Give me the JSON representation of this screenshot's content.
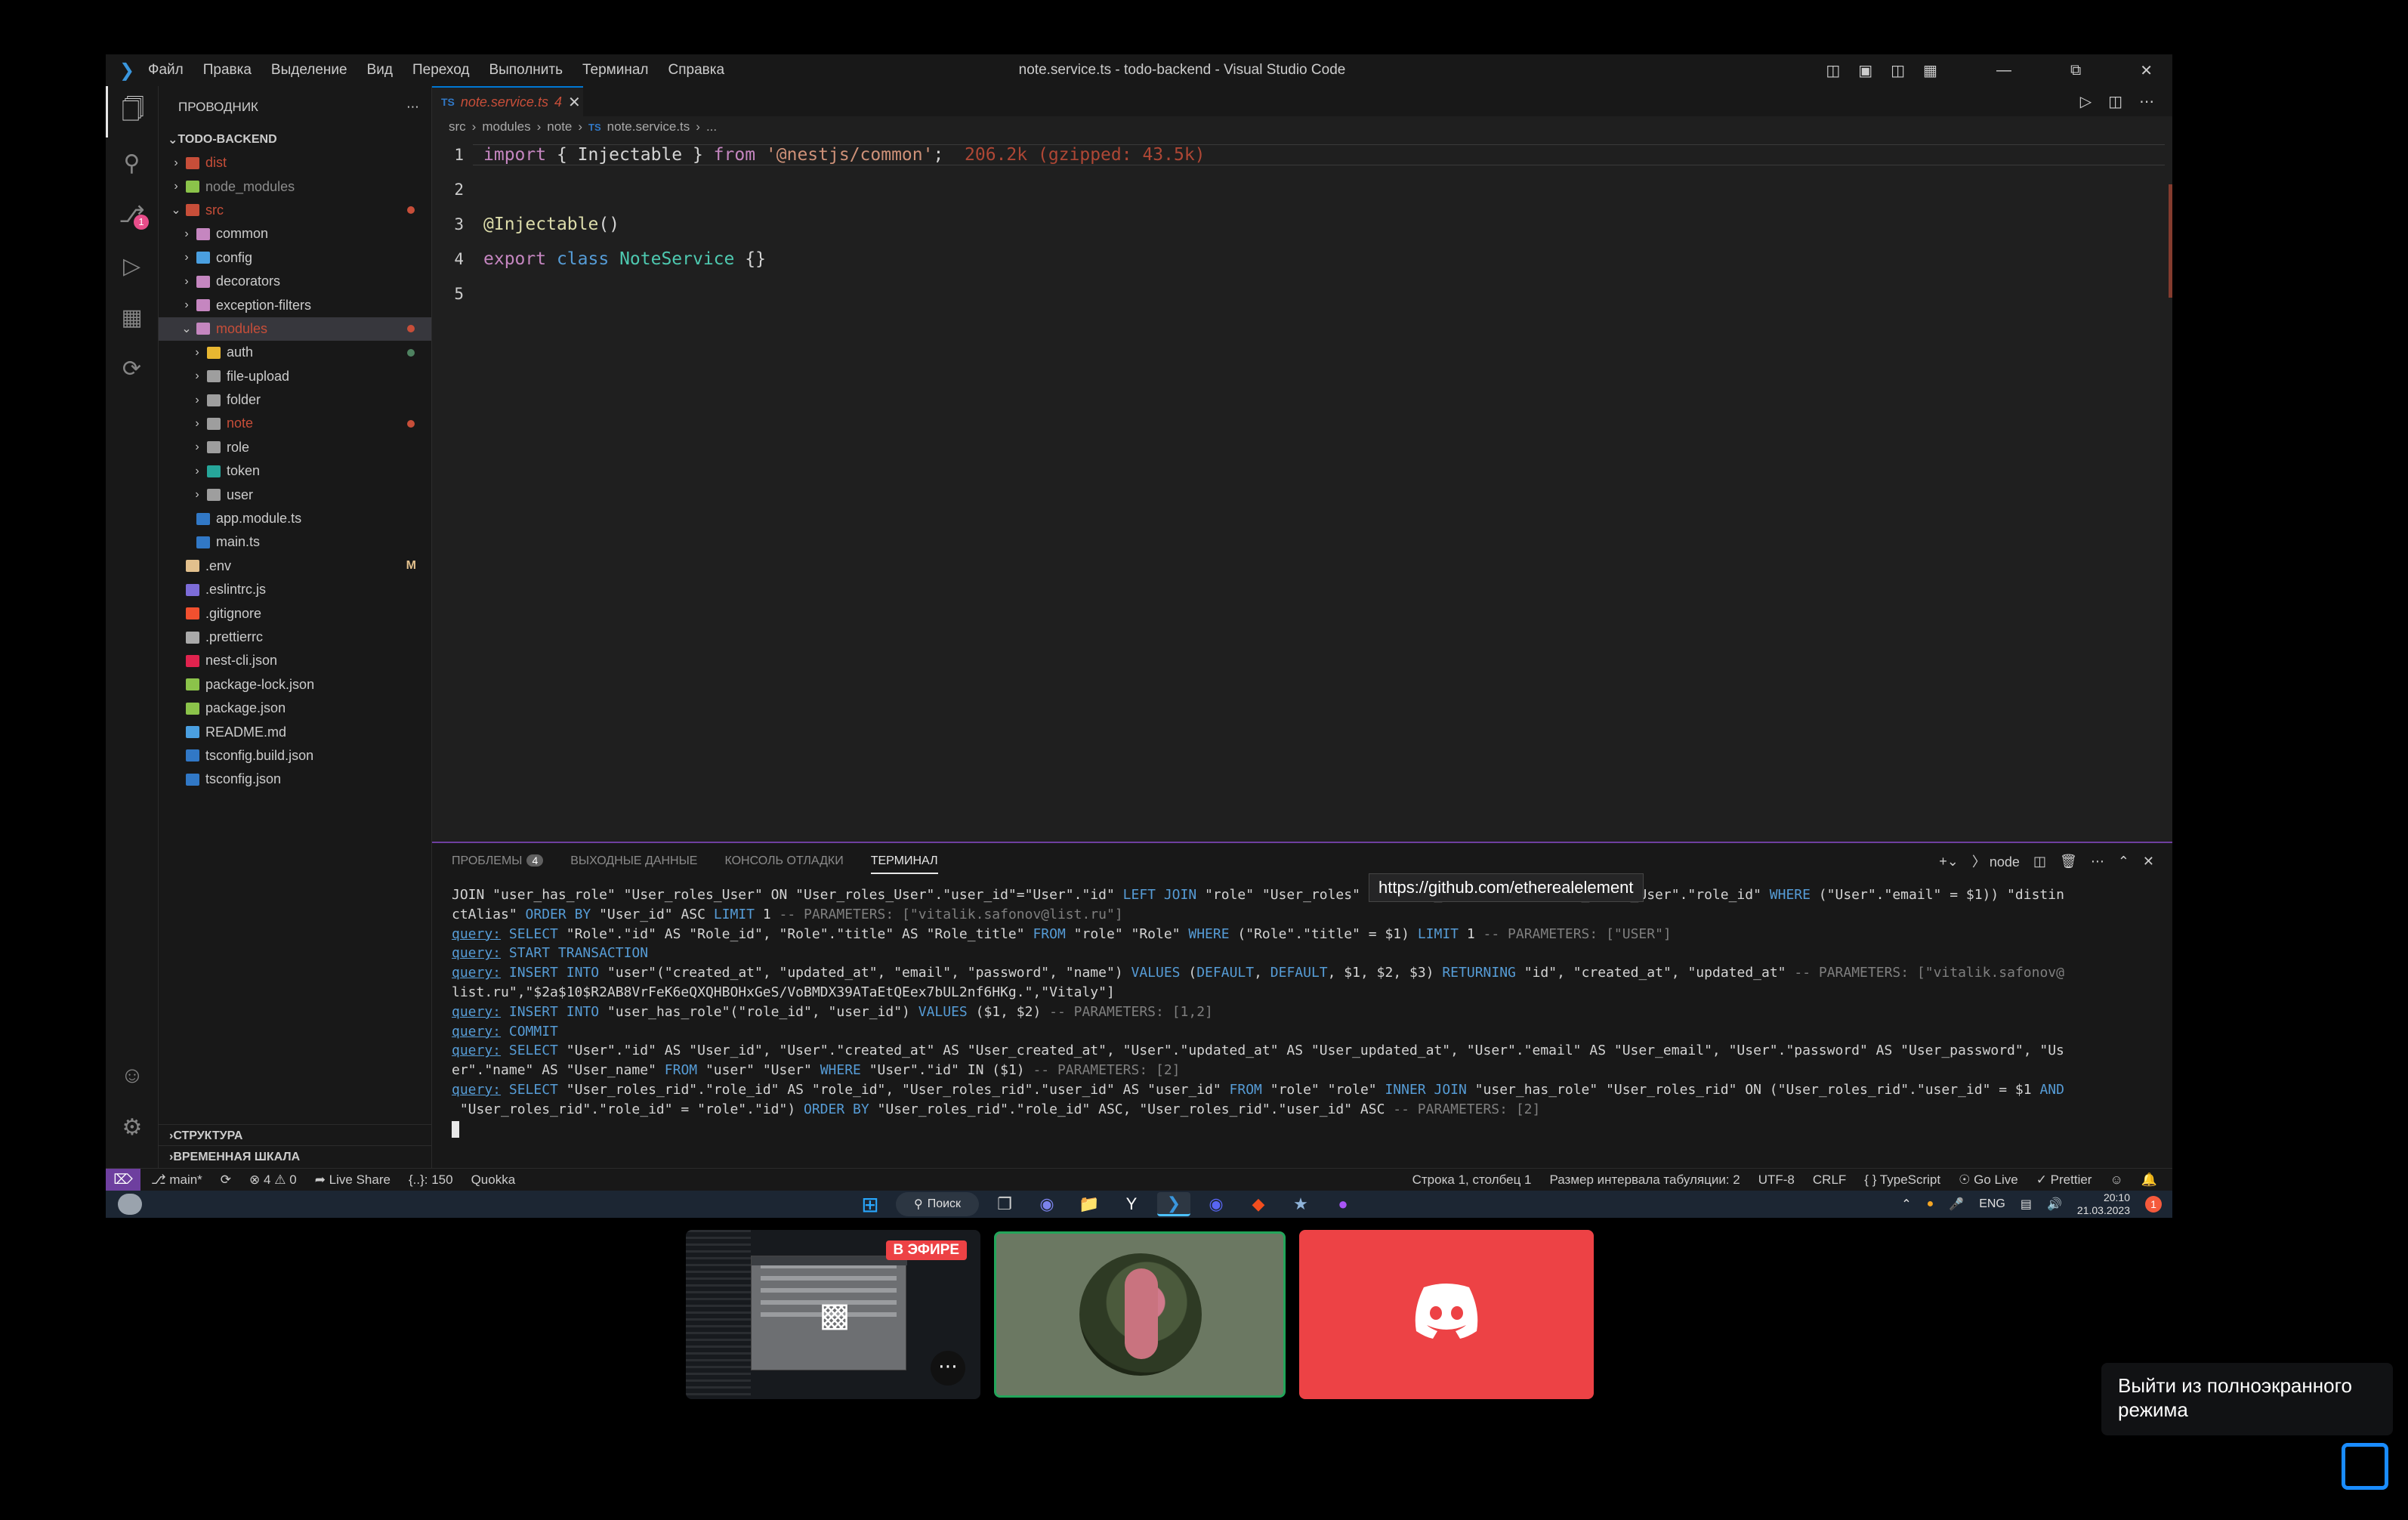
{
  "window": {
    "title": "note.service.ts - todo-backend - Visual Studio Code",
    "menu": [
      "Файл",
      "Правка",
      "Выделение",
      "Вид",
      "Переход",
      "Выполнить",
      "Терминал",
      "Справка"
    ]
  },
  "activity_bar": {
    "scm_badge": "1"
  },
  "explorer": {
    "header": "ПРОВОДНИК",
    "root": "TODO-BACKEND",
    "items": [
      {
        "label": "dist",
        "icon": "folder-dist-icon",
        "color": "#c74e39"
      },
      {
        "label": "node_modules",
        "icon": "folder-node-icon",
        "color": "#8bc34a"
      },
      {
        "label": "src",
        "icon": "folder-src-icon",
        "color": "#c74e39"
      },
      {
        "label": "common",
        "icon": "folder-icon",
        "color": "#c586c0"
      },
      {
        "label": "config",
        "icon": "folder-config-icon",
        "color": "#4a9fe0"
      },
      {
        "label": "decorators",
        "icon": "folder-icon",
        "color": "#c586c0"
      },
      {
        "label": "exception-filters",
        "icon": "folder-icon",
        "color": "#c586c0"
      },
      {
        "label": "modules",
        "icon": "folder-icon",
        "color": "#c586c0"
      },
      {
        "label": "auth",
        "icon": "folder-auth-icon",
        "color": "#e8b731"
      },
      {
        "label": "file-upload",
        "icon": "folder-icon",
        "color": "#9e9e9e"
      },
      {
        "label": "folder",
        "icon": "folder-icon",
        "color": "#9e9e9e"
      },
      {
        "label": "note",
        "icon": "folder-icon",
        "color": "#9e9e9e"
      },
      {
        "label": "role",
        "icon": "folder-icon",
        "color": "#9e9e9e"
      },
      {
        "label": "token",
        "icon": "folder-token-icon",
        "color": "#26a69a"
      },
      {
        "label": "user",
        "icon": "folder-icon",
        "color": "#9e9e9e"
      },
      {
        "label": "app.module.ts",
        "icon": "nest-file-icon",
        "color": "#3178c6"
      },
      {
        "label": "main.ts",
        "icon": "ts-file-icon",
        "color": "#3178c6"
      },
      {
        "label": ".env",
        "icon": "env-file-icon",
        "color": "#e2c08d"
      },
      {
        "label": ".eslintrc.js",
        "icon": "eslint-file-icon",
        "color": "#7d6cd8"
      },
      {
        "label": ".gitignore",
        "icon": "git-file-icon",
        "color": "#f1502f"
      },
      {
        "label": ".prettierrc",
        "icon": "prettier-file-icon",
        "color": "#aaaaaa"
      },
      {
        "label": "nest-cli.json",
        "icon": "nest-file-icon",
        "color": "#e0234e"
      },
      {
        "label": "package-lock.json",
        "icon": "npm-file-icon",
        "color": "#8bc34a"
      },
      {
        "label": "package.json",
        "icon": "npm-file-icon",
        "color": "#8bc34a"
      },
      {
        "label": "README.md",
        "icon": "info-file-icon",
        "color": "#4a9fe0"
      },
      {
        "label": "tsconfig.build.json",
        "icon": "tsconfig-file-icon",
        "color": "#3178c6"
      },
      {
        "label": "tsconfig.json",
        "icon": "tsconfig-file-icon",
        "color": "#3178c6"
      }
    ],
    "env_status": "M",
    "outline": "СТРУКТУРА",
    "timeline": "ВРЕМЕННАЯ ШКАЛА"
  },
  "editor": {
    "tab_label": "note.service.ts",
    "tab_badge": "4",
    "breadcrumb": [
      "src",
      "modules",
      "note",
      "note.service.ts",
      "..."
    ],
    "line_numbers": [
      "1",
      "2",
      "3",
      "4",
      "5"
    ],
    "lines": {
      "l1": [
        "import",
        " { ",
        "Injectable",
        " } ",
        "from",
        " ",
        "'@nestjs/common'",
        ";",
        "  206.2k (gzipped: 43.5k)"
      ],
      "l3": [
        "@",
        "Injectable",
        "()"
      ],
      "l4": [
        "export",
        " ",
        "class",
        " ",
        "NoteService",
        " {}"
      ]
    }
  },
  "tooltip": "https://github.com/etherealelement",
  "panel": {
    "tabs": [
      "ПРОБЛЕМЫ",
      "ВЫХОДНЫЕ ДАННЫЕ",
      "КОНСОЛЬ ОТЛАДКИ",
      "ТЕРМИНАЛ"
    ],
    "problems_count": "4",
    "terminal_name": "node",
    "terminal_lines": [
      "JOIN \"user_has_role\" \"User_roles_User\" ON \"User_roles_User\".\"user_id\"=\"User\".\"id\" LEFT JOIN \"role\" \"User_roles\" ON \"User_roles\".\"id\"=\"User_roles_User\".\"role_id\" WHERE (\"User\".\"email\" = $1)) \"distin",
      "ctAlias\" ORDER BY \"User_id\" ASC LIMIT 1 -- PARAMETERS: [\"vitalik.safonov@list.ru\"]",
      "query: SELECT \"Role\".\"id\" AS \"Role_id\", \"Role\".\"title\" AS \"Role_title\" FROM \"role\" \"Role\" WHERE (\"Role\".\"title\" = $1) LIMIT 1 -- PARAMETERS: [\"USER\"]",
      "query: START TRANSACTION",
      "query: INSERT INTO \"user\"(\"created_at\", \"updated_at\", \"email\", \"password\", \"name\") VALUES (DEFAULT, DEFAULT, $1, $2, $3) RETURNING \"id\", \"created_at\", \"updated_at\" -- PARAMETERS: [\"vitalik.safonov@",
      "list.ru\",\"$2a$10$R2AB8VrFeK6eQXQHBOHxGeS/VoBMDX39ATaEtQEex7bUL2nf6HKg.\",\"Vitaly\"]",
      "query: INSERT INTO \"user_has_role\"(\"role_id\", \"user_id\") VALUES ($1, $2) -- PARAMETERS: [1,2]",
      "query: COMMIT",
      "query: SELECT \"User\".\"id\" AS \"User_id\", \"User\".\"created_at\" AS \"User_created_at\", \"User\".\"updated_at\" AS \"User_updated_at\", \"User\".\"email\" AS \"User_email\", \"User\".\"password\" AS \"User_password\", \"Us",
      "er\".\"name\" AS \"User_name\" FROM \"user\" \"User\" WHERE \"User\".\"id\" IN ($1) -- PARAMETERS: [2]",
      "query: SELECT \"User_roles_rid\".\"role_id\" AS \"role_id\", \"User_roles_rid\".\"user_id\" AS \"user_id\" FROM \"role\" \"role\" INNER JOIN \"user_has_role\" \"User_roles_rid\" ON (\"User_roles_rid\".\"user_id\" = $1 AND",
      " \"User_roles_rid\".\"role_id\" = \"role\".\"id\") ORDER BY \"User_roles_rid\".\"role_id\" ASC, \"User_roles_rid\".\"user_id\" ASC -- PARAMETERS: [2]"
    ]
  },
  "status_bar": {
    "branch": "main*",
    "errors": "4",
    "warnings": "0",
    "live_share": "Live Share",
    "selection": "{..}: 150",
    "quokka": "Quokka",
    "position": "Строка 1, столбец 1",
    "indent": "Размер интервала табуляции: 2",
    "encoding": "UTF-8",
    "eol": "CRLF",
    "language": "TypeScript",
    "golive": "Go Live",
    "prettier": "Prettier"
  },
  "taskbar": {
    "search": "Поиск",
    "lang": "ENG",
    "time": "20:10",
    "date": "21.03.2023",
    "notif": "1"
  },
  "call": {
    "live_label": "В ЭФИРЕ"
  },
  "fullscreen_tooltip": "Выйти из полноэкранного режима"
}
